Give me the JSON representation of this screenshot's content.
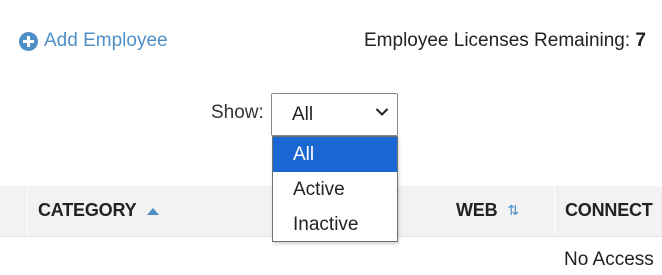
{
  "toolbar": {
    "add_employee_label": "Add Employee",
    "licenses_label": "Employee Licenses Remaining:",
    "licenses_count": "7"
  },
  "filter": {
    "show_label": "Show:",
    "selected_value": "All",
    "options": [
      "All",
      "Active",
      "Inactive"
    ]
  },
  "table": {
    "columns": [
      {
        "label": "CATEGORY",
        "sort": "ascending"
      },
      {
        "label": "WEB",
        "sort": "sortable"
      },
      {
        "label": "CONNECT",
        "sort": "ascending"
      }
    ],
    "rows": [
      {
        "connect": "No Access"
      }
    ]
  },
  "colors": {
    "accent": "#4f8fc7",
    "selected_option": "#1a66d2",
    "header_bg": "#f2f2f2"
  },
  "icons": {
    "add": "plus-circle-icon",
    "dropdown": "chevron-down-icon",
    "sort_ascending": "sort-ascending-icon",
    "sortable": "sort-arrows-icon"
  }
}
